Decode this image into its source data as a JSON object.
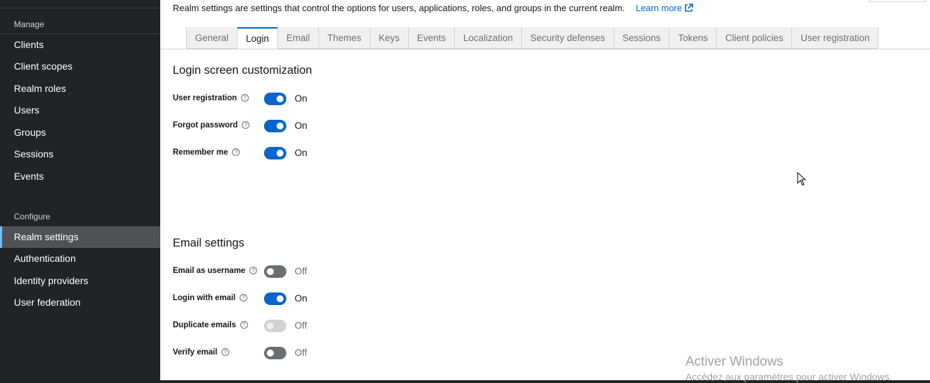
{
  "sidebar": {
    "manage_title": "Manage",
    "manage_items": [
      "Clients",
      "Client scopes",
      "Realm roles",
      "Users",
      "Groups",
      "Sessions",
      "Events"
    ],
    "configure_title": "Configure",
    "configure_items": [
      "Realm settings",
      "Authentication",
      "Identity providers",
      "User federation"
    ],
    "active_item": "Realm settings"
  },
  "header": {
    "description": "Realm settings are settings that control the options for users, applications, roles, and groups in the current realm.",
    "learn_more": "Learn more"
  },
  "tabs": [
    "General",
    "Login",
    "Email",
    "Themes",
    "Keys",
    "Events",
    "Localization",
    "Security defenses",
    "Sessions",
    "Tokens",
    "Client policies",
    "User registration"
  ],
  "active_tab": "Login",
  "login_section": {
    "title": "Login screen customization",
    "settings": [
      {
        "label": "User registration",
        "state": "On",
        "enabled": true,
        "disabled": false
      },
      {
        "label": "Forgot password",
        "state": "On",
        "enabled": true,
        "disabled": false
      },
      {
        "label": "Remember me",
        "state": "On",
        "enabled": true,
        "disabled": false
      }
    ]
  },
  "email_section": {
    "title": "Email settings",
    "settings": [
      {
        "label": "Email as username",
        "state": "Off",
        "enabled": false,
        "disabled": false
      },
      {
        "label": "Login with email",
        "state": "On",
        "enabled": true,
        "disabled": false
      },
      {
        "label": "Duplicate emails",
        "state": "Off",
        "enabled": false,
        "disabled": true
      },
      {
        "label": "Verify email",
        "state": "Off",
        "enabled": false,
        "disabled": false
      }
    ]
  },
  "watermark": {
    "line1": "Activer Windows",
    "line2": "Accédez aux paramètres pour activer Windows."
  },
  "colors": {
    "sidebar_bg": "#212427",
    "accent": "#0066cc",
    "active_nav": "#4f5255"
  }
}
